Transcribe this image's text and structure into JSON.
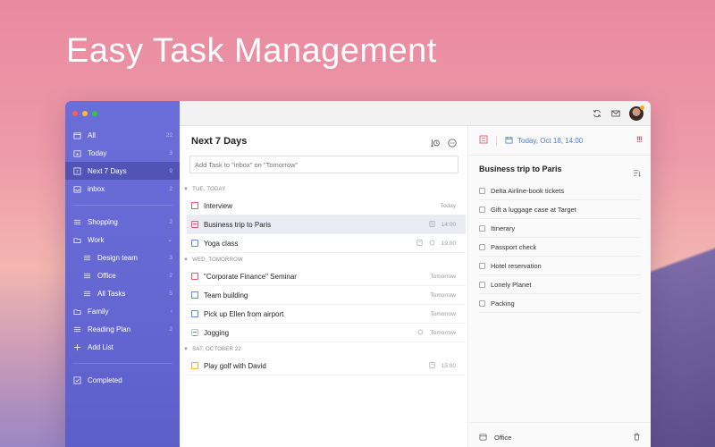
{
  "hero": {
    "title": "Easy Task Management"
  },
  "sidebar": {
    "items": [
      {
        "label": "All",
        "count": "22",
        "icon": "calendar-icon"
      },
      {
        "label": "Today",
        "count": "3",
        "icon": "calendar-day-icon"
      },
      {
        "label": "Next 7 Days",
        "count": "9",
        "icon": "calendar-week-icon"
      },
      {
        "label": "inbox",
        "count": "2",
        "icon": "inbox-icon"
      }
    ],
    "lists": [
      {
        "label": "Shopping",
        "count": "2",
        "icon": "list-icon"
      },
      {
        "label": "Work",
        "count": "⌄",
        "icon": "folder-icon"
      },
      {
        "label": "Design team",
        "count": "3",
        "icon": "list-icon"
      },
      {
        "label": "Office",
        "count": "2",
        "icon": "list-icon"
      },
      {
        "label": "All Tasks",
        "count": "5",
        "icon": "list-icon"
      },
      {
        "label": "Family",
        "count": "‹",
        "icon": "folder-icon"
      },
      {
        "label": "Reading Plan",
        "count": "2",
        "icon": "list-icon"
      },
      {
        "label": "Add List",
        "count": "",
        "icon": "plus-icon"
      }
    ],
    "completed": {
      "label": "Completed",
      "icon": "check-square-icon"
    }
  },
  "middle": {
    "title": "Next 7 Days",
    "add_placeholder": "Add Task to \"inbox\" on \"Tomorrow\"",
    "sections": [
      {
        "heading": "TUE, TODAY",
        "tasks": [
          {
            "label": "Interview",
            "meta": "Today",
            "color": "#e5596b"
          },
          {
            "label": "Business trip to Paris",
            "meta": "14:00",
            "color": "#e5596b"
          },
          {
            "label": "Yoga class",
            "meta": "19:00",
            "color": "#5b8de8"
          }
        ]
      },
      {
        "heading": "WED, TOMORROW",
        "tasks": [
          {
            "label": "\"Corporate Finance\" Seminar",
            "meta": "Tomorrow",
            "color": "#e5596b"
          },
          {
            "label": "Team building",
            "meta": "Tomorrow",
            "color": "#5b8de8"
          },
          {
            "label": "Pick up Ellen from airport",
            "meta": "Tomorrow",
            "color": "#5b8de8"
          },
          {
            "label": "Jogging",
            "meta": "Tomorrow",
            "color": "#b8b8b8"
          }
        ]
      },
      {
        "heading": "SAT, OCTOBER 22",
        "tasks": [
          {
            "label": "Play golf with David",
            "meta": "15:00",
            "color": "#f0b23a"
          }
        ]
      }
    ]
  },
  "detail": {
    "date": "Today, Oct 18, 14:00",
    "priority": "!!!",
    "title": "Business trip to Paris",
    "checklist": [
      "Delta Airline-book tickets",
      "Gift a luggage case at Target",
      "Itinerary",
      "Passport check",
      "Hotel reservation",
      "Lonely Planet",
      "Packing"
    ],
    "list_name": "Office"
  },
  "colors": {
    "sidebar": "#6466d2",
    "accent_blue": "#4f7fd8",
    "priority_red": "#e5596b"
  }
}
